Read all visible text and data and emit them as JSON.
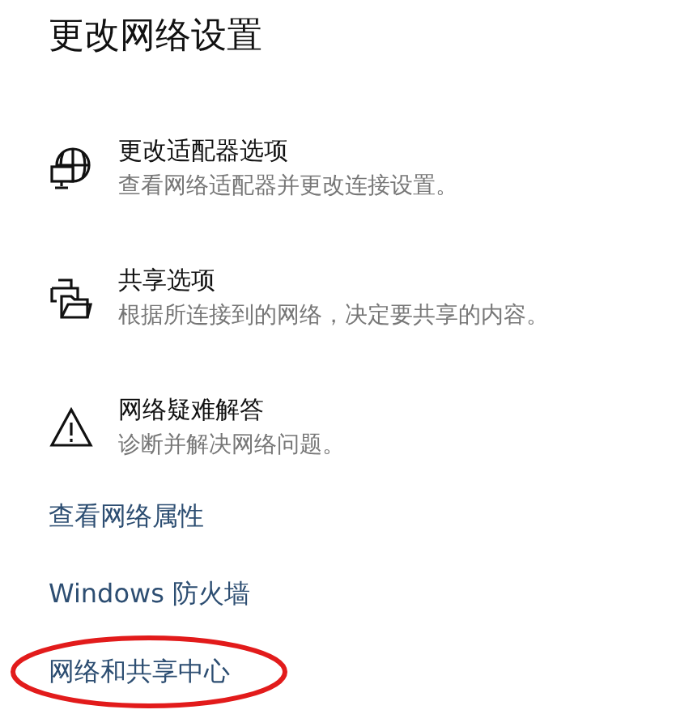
{
  "title": "更改网络设置",
  "options": [
    {
      "kind": "adapter",
      "title": "更改适配器选项",
      "description": "查看网络适配器并更改连接设置。"
    },
    {
      "kind": "sharing",
      "title": "共享选项",
      "description": "根据所连接到的网络，决定要共享的内容。"
    },
    {
      "kind": "troubleshoot",
      "title": "网络疑难解答",
      "description": "诊断并解决网络问题。"
    }
  ],
  "links": [
    {
      "label": "查看网络属性",
      "circled": false
    },
    {
      "label": "Windows 防火墙",
      "circled": false
    },
    {
      "label": "网络和共享中心",
      "circled": true
    }
  ]
}
